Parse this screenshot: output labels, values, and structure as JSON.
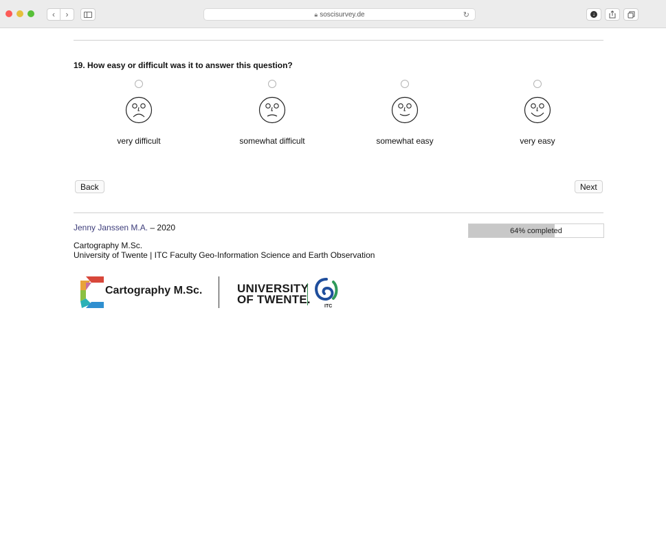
{
  "browser": {
    "url": "soscisurvey.de",
    "back_glyph": "‹",
    "forward_glyph": "›",
    "reload_glyph": "↻"
  },
  "question": {
    "text": "19. How easy or difficult was it to answer this question?",
    "options": [
      {
        "label": "very difficult",
        "face": "very-sad",
        "selected": false
      },
      {
        "label": "somewhat difficult",
        "face": "sad",
        "selected": false
      },
      {
        "label": "somewhat easy",
        "face": "smile",
        "selected": false
      },
      {
        "label": "very easy",
        "face": "big-smile",
        "selected": false
      }
    ]
  },
  "nav": {
    "back_label": "Back",
    "next_label": "Next"
  },
  "footer": {
    "author_name": "Jenny Janssen M.A.",
    "author_year": " – 2020",
    "affiliation_line1": "Cartography M.Sc.",
    "affiliation_line2": "University of Twente | ITC Faculty Geo-Information Science and Earth Observation",
    "progress_text": "64% completed",
    "progress_fraction": 0.64
  },
  "logos": {
    "cartography_text": "Cartography M.Sc.",
    "ut_line1": "UNIVERSITY",
    "ut_line2": "OF TWENTE.",
    "itc_text": "ITC"
  },
  "colors": {
    "author_link": "#3c3c7a",
    "progress_fill": "#c8c8c8",
    "ut_accent": "#2a8a4a",
    "itc_blue": "#1f4e9c",
    "itc_green": "#2f9a5a"
  }
}
